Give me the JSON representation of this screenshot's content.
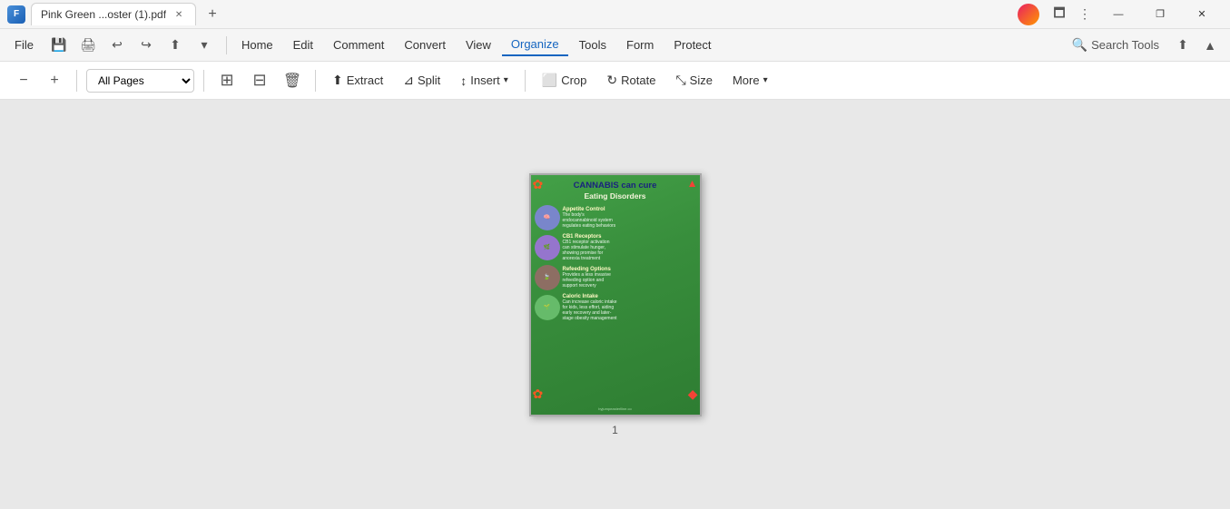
{
  "titlebar": {
    "app_icon": "F",
    "tab_title": "Pink Green ...oster (1).pdf",
    "new_tab": "+",
    "win_minimize": "—",
    "win_restore": "❐",
    "win_close": "✕"
  },
  "menubar": {
    "file": "File",
    "home": "Home",
    "edit": "Edit",
    "comment": "Comment",
    "convert": "Convert",
    "view": "View",
    "organize": "Organize",
    "tools": "Tools",
    "form": "Form",
    "protect": "Protect",
    "search_tools": "Search Tools"
  },
  "toolbar2": {
    "zoom_out": "−",
    "zoom_in": "+",
    "page_range": "All Pages",
    "extract": "Extract",
    "split": "Split",
    "insert": "Insert",
    "crop": "Crop",
    "rotate": "Rotate",
    "size": "Size",
    "more": "More"
  },
  "document": {
    "page_number": "1",
    "title_line1": "CANNABIS can cure",
    "title_line2": "Eating Disorders",
    "sections": [
      {
        "title": "Appetite\nControl",
        "desc": "The body's\nendocannabinoid system\nregulates eating behaviors"
      },
      {
        "title": "CB1\nReceptors",
        "desc": "CB1 receptor activation\ncan stimulate hunger,\nshowing promise for\nanorexia treatment"
      },
      {
        "title": "Refeeding\nOptions",
        "desc": "Provides a less invasive\nrefeeding option and\nsupport recovery"
      },
      {
        "title": "Caloric\nIntake",
        "desc": "Can increase caloric intake\nfor kids, less effort, aiding\nearly recovery and later-\nstage obesity management"
      }
    ],
    "footer": "byjumpeasterlline.co"
  }
}
